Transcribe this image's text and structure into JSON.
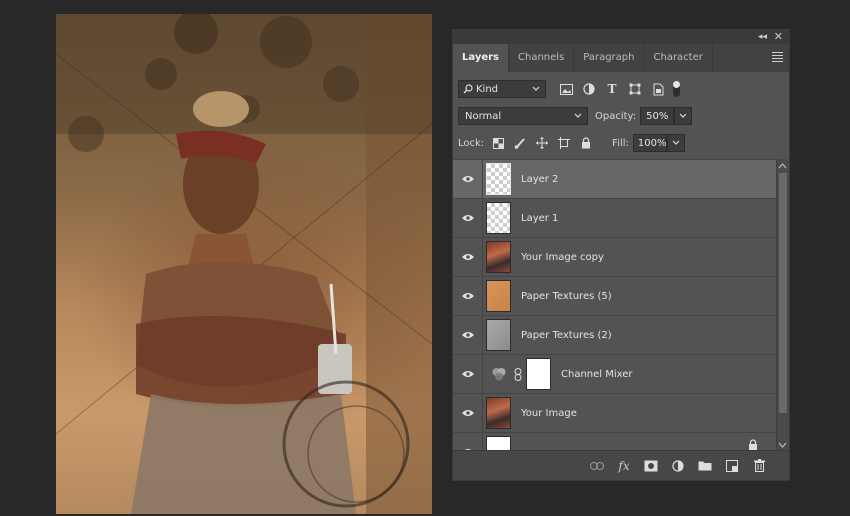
{
  "panel": {
    "tabs": [
      {
        "label": "Layers",
        "active": true
      },
      {
        "label": "Channels",
        "active": false
      },
      {
        "label": "Paragraph",
        "active": false
      },
      {
        "label": "Character",
        "active": false
      }
    ],
    "filter": {
      "value": "Kind"
    },
    "blend_mode": {
      "value": "Normal"
    },
    "opacity": {
      "label": "Opacity:",
      "value": "50%"
    },
    "lock": {
      "label": "Lock:"
    },
    "fill": {
      "label": "Fill:",
      "value": "100%"
    },
    "layers": [
      {
        "name": "Layer 2",
        "thumb": "transparent",
        "selected": true
      },
      {
        "name": "Layer 1",
        "thumb": "transparent",
        "selected": false
      },
      {
        "name": "Your Image copy",
        "thumb": "photo",
        "selected": false
      },
      {
        "name": "Paper Textures (5)",
        "thumb": "paper-orange",
        "selected": false
      },
      {
        "name": "Paper Textures (2)",
        "thumb": "paper-gray",
        "selected": false
      },
      {
        "name": "Channel Mixer",
        "thumb": "adjustment",
        "selected": false
      },
      {
        "name": "Your Image",
        "thumb": "photo",
        "selected": false
      },
      {
        "name": "",
        "thumb": "white",
        "selected": false
      }
    ]
  },
  "colors": {
    "app_bg": "#282828",
    "panel_bg": "#535353",
    "selected_layer": "#676767"
  }
}
